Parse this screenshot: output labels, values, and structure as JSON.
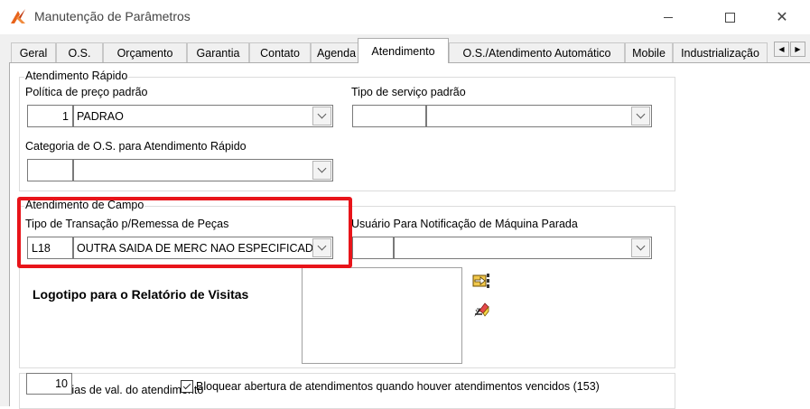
{
  "window": {
    "title": "Manutenção de Parâmetros",
    "icons": {
      "app": "app-logo-icon",
      "minimize": "minimize-icon",
      "maximize": "maximize-icon",
      "close": "close-icon"
    },
    "close_symbol": "✕"
  },
  "tabs": [
    {
      "label": "Geral"
    },
    {
      "label": "O.S."
    },
    {
      "label": "Orçamento"
    },
    {
      "label": "Garantia"
    },
    {
      "label": "Contato"
    },
    {
      "label": "Agenda"
    },
    {
      "label": "Atendimento",
      "active": true
    },
    {
      "label": "O.S./Atendimento Automático"
    },
    {
      "label": "Mobile"
    },
    {
      "label": "Industrialização"
    }
  ],
  "tab_scroll": {
    "left": "◀",
    "right": "▶"
  },
  "atendimento_rapido": {
    "caption": "Atendimento Rápido",
    "politica_label": "Política de preço padrão",
    "politica_code": "1",
    "politica_value": "PADRAO",
    "tipo_servico_label": "Tipo de serviço padrão",
    "tipo_servico_code": "",
    "tipo_servico_value": "",
    "categoria_label": "Categoria de O.S. para Atendimento Rápido",
    "categoria_code": "",
    "categoria_value": ""
  },
  "atendimento_campo": {
    "caption": "Atendimento de Campo",
    "transacao_label": "Tipo de Transação p/Remessa de Peças",
    "transacao_code": "L18",
    "transacao_value": "OUTRA SAIDA DE MERC NAO ESPECIFICADA",
    "usuario_label": "Usuário Para Notificação de Máquina Parada",
    "usuario_code": "",
    "usuario_value": "",
    "logotipo_label": "Logotipo para o Relatório de Visitas",
    "tool_icons": [
      "load-image-icon",
      "clear-image-icon"
    ]
  },
  "validade": {
    "dias_label": "Nro. de dias de val. do atendimento",
    "dias_value": "10",
    "bloquear_label": "Bloquear abertura de atendimentos quando houver atendimentos vencidos (153)",
    "bloquear_checked": true
  },
  "colors": {
    "highlight": "#e8141a",
    "window_bg": "#f0f0f0",
    "page_bg": "#ffffff",
    "app_icon": "#e8631a"
  }
}
